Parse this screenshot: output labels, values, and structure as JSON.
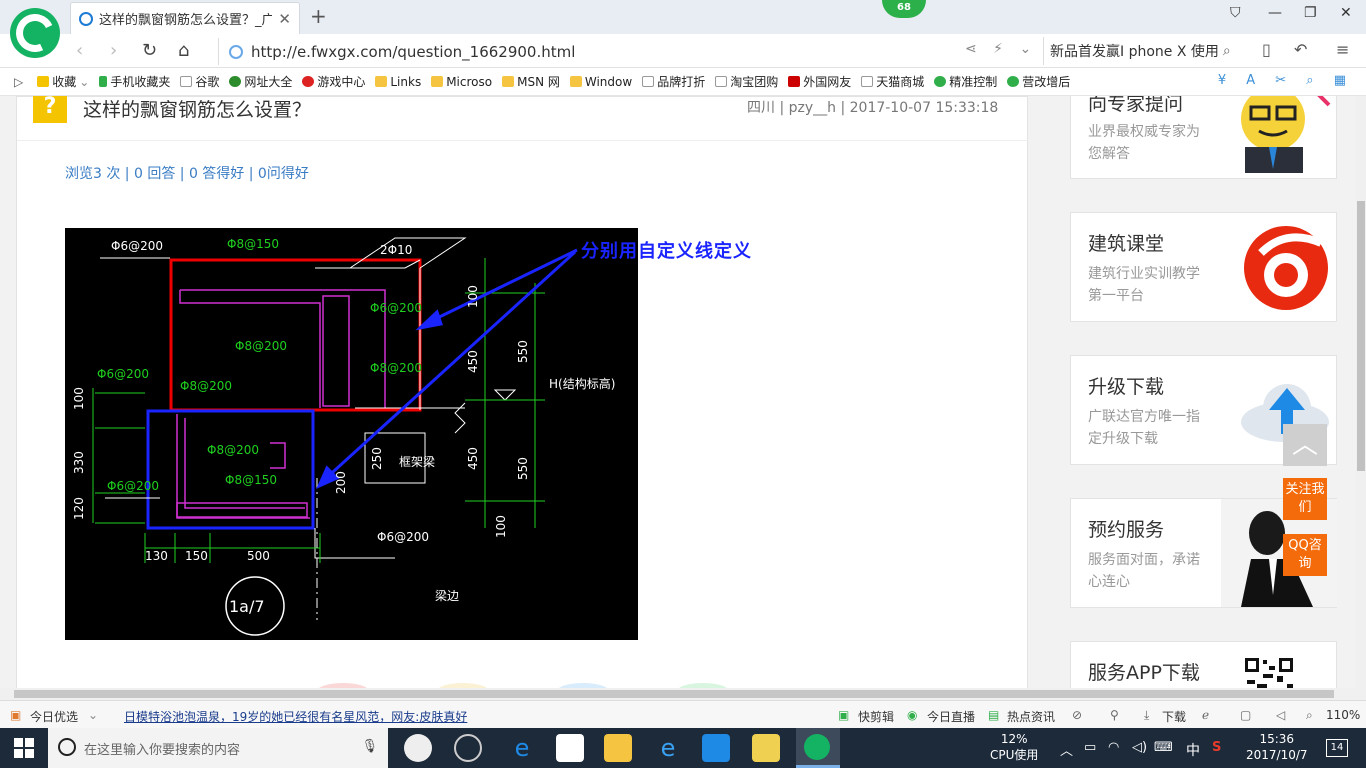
{
  "browser": {
    "tab_title": "这样的飘窗钢筋怎么设置？_广联",
    "badge": "68",
    "url": "http://e.fwxgx.com/question_1662900.html",
    "search_text": "新品首发赢I phone X 使用"
  },
  "favorites": [
    "收藏",
    "手机收藏夹",
    "谷歌",
    "网址大全",
    "游戏中心",
    "Links",
    "Microso",
    "MSN 网",
    "Window",
    "品牌打折",
    "淘宝团购",
    "外国网友",
    "天猫商城",
    "精准控制",
    "营改增后"
  ],
  "question": {
    "title": "这样的飘窗钢筋怎么设置？",
    "meta": "四川 | pzy__h | 2017-10-07 15:33:18",
    "stats": "浏览3 次 | 0 回答 | 0 答得好 | 0问得好"
  },
  "drawing": {
    "annotation": "分别用自定义线定义",
    "labels": {
      "phi6_top": "Φ6@200",
      "phi8_150_top": "Φ8@150",
      "phi10": "2Φ10",
      "phi6_right": "Φ6@200",
      "phi8_mid": "Φ8@200",
      "phi8_right": "Φ8@200",
      "phi6_left": "Φ6@200",
      "phi8_left": "Φ8@200",
      "phi8_low": "Φ8@200",
      "phi8_150_low": "Φ8@150",
      "phi6_bottom_left": "Φ6@200",
      "phi6_bottom": "Φ6@200",
      "h_label": "H(结构标高)",
      "frame_beam": "框架梁",
      "beam_edge": "梁边",
      "detail": "1a/7",
      "dim_100a": "100",
      "dim_450a": "450",
      "dim_550a": "550",
      "dim_450b": "450",
      "dim_550b": "550",
      "dim_100b": "100",
      "dim_250": "250",
      "dim_200": "200",
      "dim_100_left": "100",
      "dim_330": "330",
      "dim_120": "120",
      "dim_130": "130",
      "dim_150": "150",
      "dim_500": "500"
    }
  },
  "sidebar": {
    "cards": [
      {
        "title": "向专家提问",
        "desc": "业界最权威专家为您解答"
      },
      {
        "title": "建筑课堂",
        "desc": "建筑行业实训教学第一平台"
      },
      {
        "title": "升级下载",
        "desc": "广联达官方唯一指定升级下载"
      },
      {
        "title": "预约服务",
        "desc": "服务面对面，承诺心连心"
      },
      {
        "title": "服务APP下载",
        "desc": ""
      }
    ],
    "float_follow": "关注我们",
    "float_qq": "QQ咨询"
  },
  "statusbar": {
    "today": "今日优选",
    "news": "日模特浴池泡温泉，19岁的她已经很有名星风范，网友:皮肤真好",
    "quick_cut": "快剪辑",
    "live": "今日直播",
    "hot": "热点资讯",
    "download": "下载",
    "zoom": "110%"
  },
  "taskbar": {
    "search_placeholder": "在这里输入你要搜索的内容",
    "cpu_pct": "12%",
    "cpu_label": "CPU使用",
    "ime": "中",
    "time": "15:36",
    "date": "2017/10/7",
    "notifications": "14"
  }
}
